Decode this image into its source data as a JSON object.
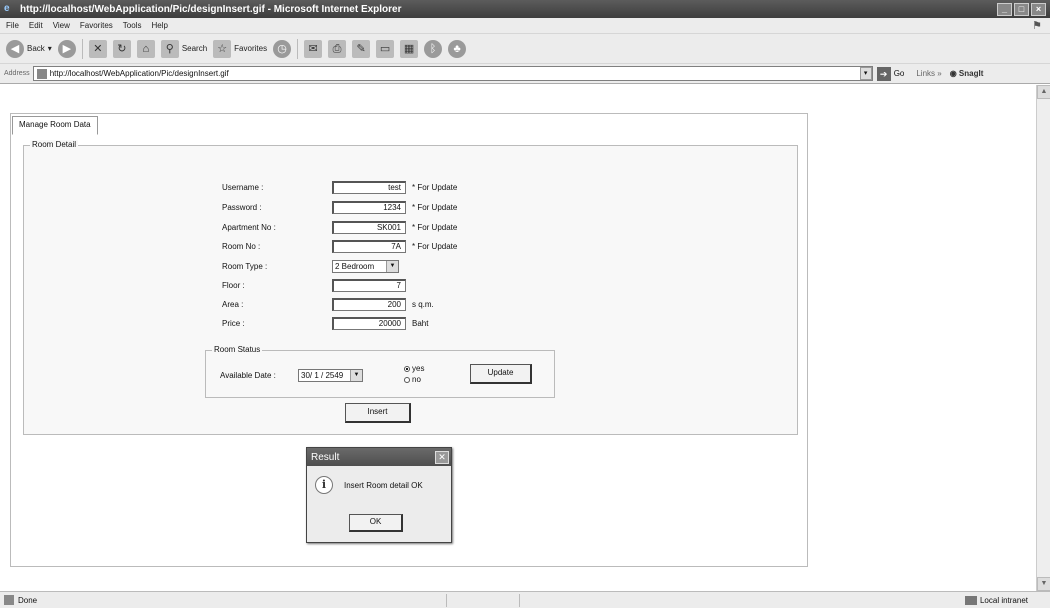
{
  "window": {
    "title": "http://localhost/WebApplication/Pic/designInsert.gif - Microsoft Internet Explorer",
    "controls": [
      "_",
      "□",
      "×"
    ]
  },
  "menu": [
    "File",
    "Edit",
    "View",
    "Favorites",
    "Tools",
    "Help"
  ],
  "toolbar": {
    "back": "Back",
    "search": "Search",
    "favorites": "Favorites"
  },
  "address": {
    "label": "Address",
    "url": "http://localhost/WebApplication/Pic/designInsert.gif",
    "go": "Go",
    "links": "Links",
    "snagit": "SnagIt"
  },
  "page": {
    "tab_label": "Manage Room Data",
    "room_detail_legend": "Room Detail",
    "fields": [
      {
        "label": "Username :",
        "value": "test",
        "note": "* For Update"
      },
      {
        "label": "Password :",
        "value": "1234",
        "note": "* For Update"
      },
      {
        "label": "Apartment No :",
        "value": "SK001",
        "note": "* For Update"
      },
      {
        "label": "Room No :",
        "value": "7A",
        "note": "* For Update"
      },
      {
        "label": "Room Type :",
        "value": "2 Bedroom",
        "note": ""
      },
      {
        "label": "Floor :",
        "value": "7",
        "note": ""
      },
      {
        "label": "Area :",
        "value": "200",
        "note": "s q.m."
      },
      {
        "label": "Price :",
        "value": "20000",
        "note": "Baht"
      }
    ],
    "room_status_legend": "Room Status",
    "available_date_label": "Available Date :",
    "available_date_value": "30/ 1 / 2549",
    "radio_yes": "yes",
    "radio_no": "no",
    "update_button": "Update",
    "insert_button": "Insert"
  },
  "dialog": {
    "title": "Result",
    "message": "Insert Room detail OK",
    "ok": "OK"
  },
  "status": {
    "left": "Done",
    "zone": "Local intranet"
  }
}
